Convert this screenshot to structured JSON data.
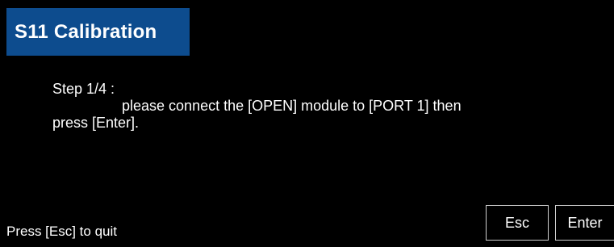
{
  "dialog": {
    "title": "S11 Calibration",
    "step": "Step 1/4 :",
    "instruction_line1": "please connect the [OPEN] module to [PORT 1] then",
    "instruction_line2": "press [Enter].",
    "quit_hint": "Press [Esc] to quit"
  },
  "buttons": {
    "esc_label": "Esc",
    "enter_label": "Enter"
  },
  "colors": {
    "background": "#000000",
    "title_bar": "#0d4c8e",
    "text": "#ffffff",
    "button_border": "#cfcfcf"
  }
}
